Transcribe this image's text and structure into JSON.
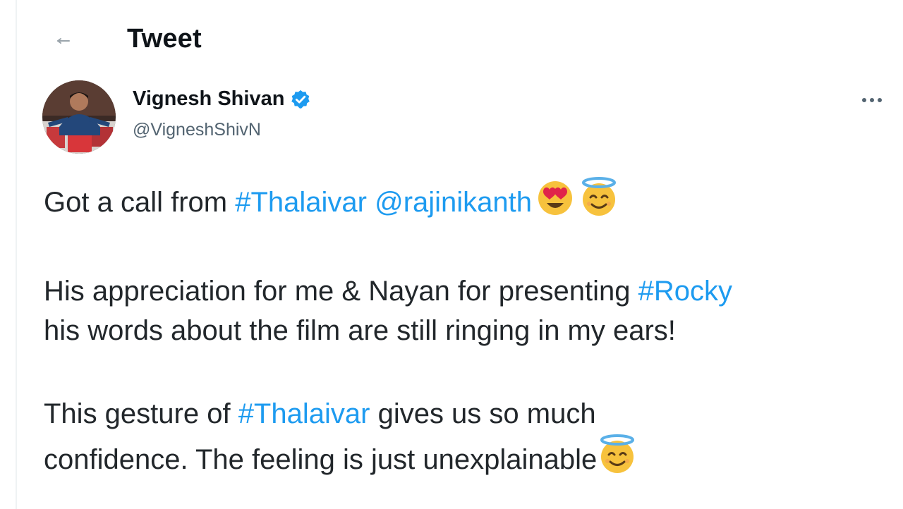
{
  "header": {
    "title": "Tweet",
    "back_icon": "arrow-left-icon"
  },
  "author": {
    "name": "Vignesh Shivan",
    "handle": "@VigneshShivN",
    "verified_icon": "verified-badge-icon",
    "verified_color": "#1d9bf0"
  },
  "more_icon": "more-options-icon",
  "tweet": {
    "p1": {
      "text1": "Got a call from ",
      "hashtag": "#Thalaivar",
      "space": " ",
      "mention": "@rajinikanth",
      "emoji1": "smiling-face-with-heart-eyes-icon",
      "emoji2": "smiling-face-with-halo-icon"
    },
    "p2": {
      "text1": "His appreciation for me & Nayan for presenting ",
      "hashtag": "#Rocky",
      "text2": "his words about the film are still ringing in my ears!"
    },
    "p3": {
      "text1": "This gesture of ",
      "hashtag": "#Thalaivar",
      "text2": " gives us so much",
      "text3": "confidence. The feeling is just unexplainable",
      "emoji": "smiling-face-with-halo-icon"
    }
  },
  "colors": {
    "link": "#1d9bf0",
    "text": "#0f1419",
    "secondary": "#536471"
  }
}
